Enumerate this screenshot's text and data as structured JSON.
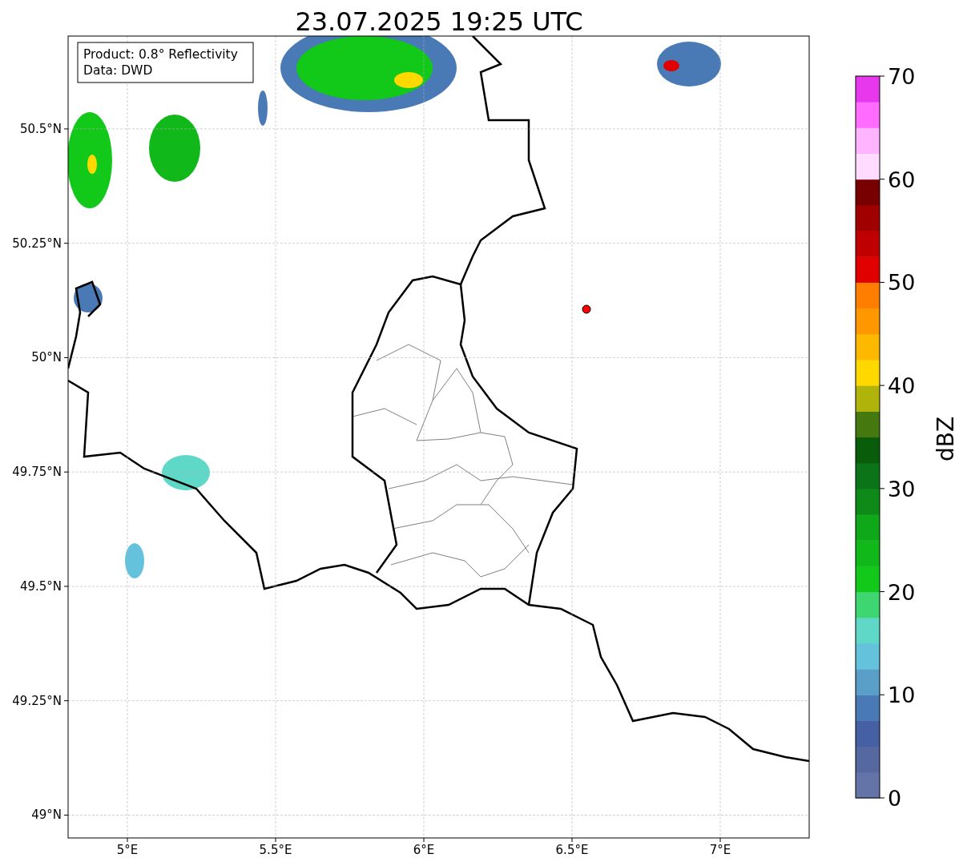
{
  "title": "23.07.2025 19:25 UTC",
  "info_box": {
    "lines": [
      "Product: 0.8° Reflectivity",
      "Data: DWD"
    ]
  },
  "map": {
    "xticks": [
      "5°E",
      "5.5°E",
      "6°E",
      "6.5°E",
      "7°E"
    ],
    "yticks": [
      "50.5°N",
      "50.25°N",
      "50°N",
      "49.75°N",
      "49.5°N",
      "49.25°N",
      "49°N"
    ]
  },
  "colorbar": {
    "label": "dBZ",
    "ticks": [
      "70",
      "60",
      "50",
      "40",
      "30",
      "20",
      "10",
      "0"
    ],
    "bins": [
      {
        "color": "#6474a8"
      },
      {
        "color": "#5568a0"
      },
      {
        "color": "#4560a3"
      },
      {
        "color": "#4a7ab5"
      },
      {
        "color": "#5a9fc8"
      },
      {
        "color": "#65c2dc"
      },
      {
        "color": "#60d8c8"
      },
      {
        "color": "#3dd670"
      },
      {
        "color": "#12c818"
      },
      {
        "color": "#10b81a"
      },
      {
        "color": "#0ea818"
      },
      {
        "color": "#0d8a18"
      },
      {
        "color": "#0b7418"
      },
      {
        "color": "#085c0a"
      },
      {
        "color": "#467810"
      },
      {
        "color": "#b0b40a"
      },
      {
        "color": "#ffd800"
      },
      {
        "color": "#ffb800"
      },
      {
        "color": "#ff9800"
      },
      {
        "color": "#ff7e00"
      },
      {
        "color": "#e00000"
      },
      {
        "color": "#c00000"
      },
      {
        "color": "#a00000"
      },
      {
        "color": "#780000"
      },
      {
        "color": "#ffdcff"
      },
      {
        "color": "#ffb4ff"
      },
      {
        "color": "#ff6cff"
      },
      {
        "color": "#e838ee"
      }
    ]
  }
}
